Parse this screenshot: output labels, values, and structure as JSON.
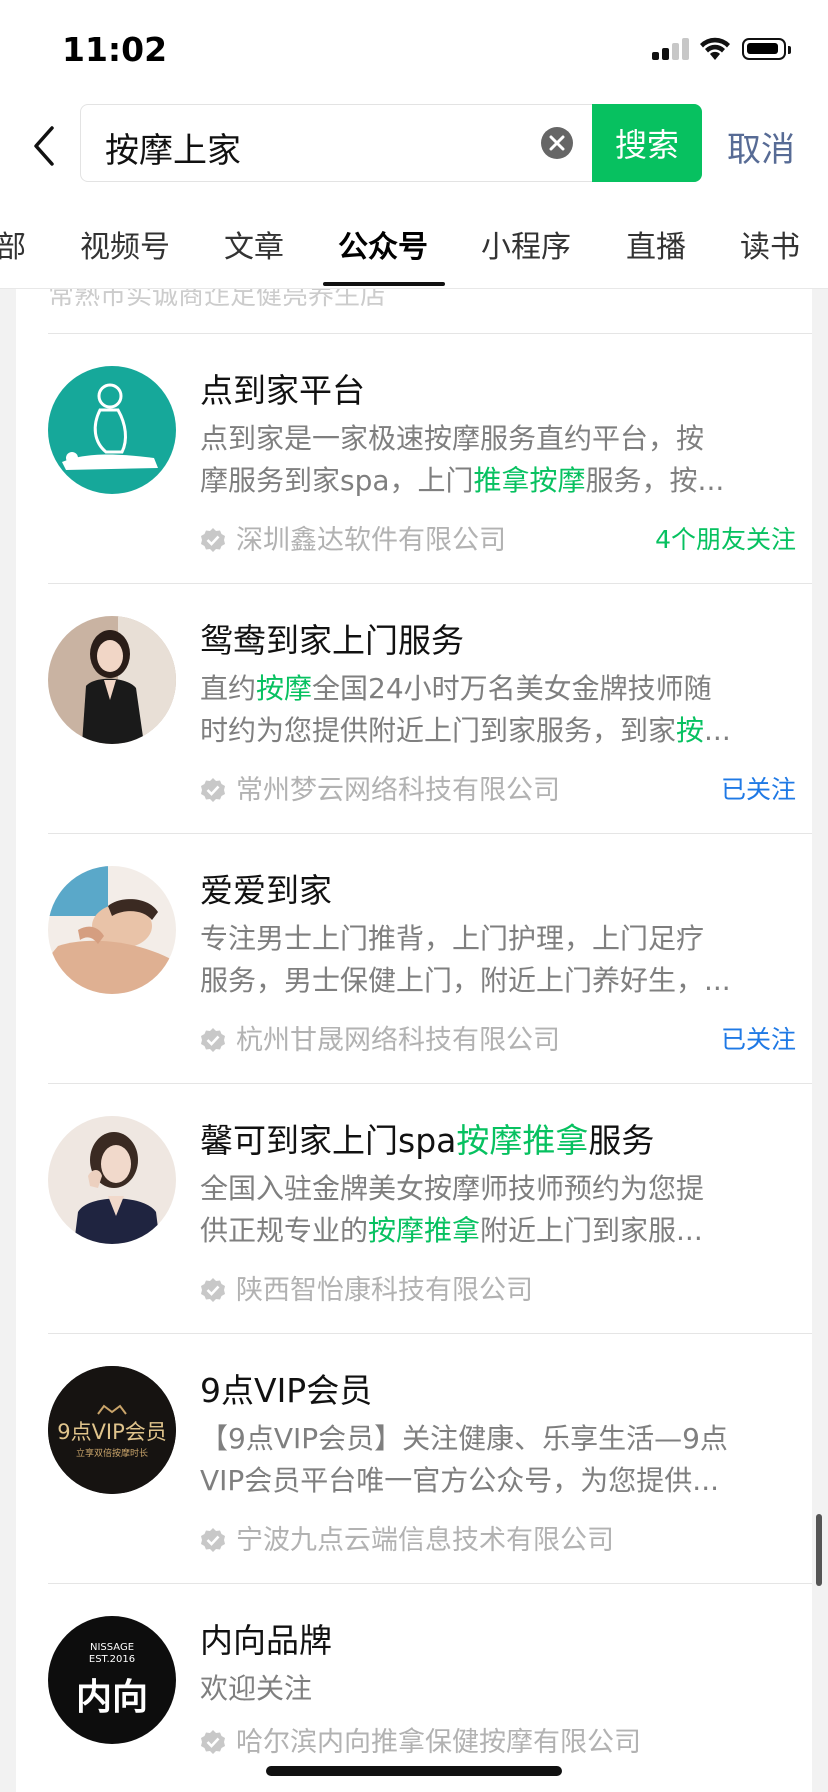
{
  "status_bar": {
    "time": "11:02"
  },
  "search": {
    "query": "按摩上家",
    "button_label": "搜索",
    "cancel_label": "取消"
  },
  "tabs": [
    {
      "label": "部"
    },
    {
      "label": "视频号"
    },
    {
      "label": "文章"
    },
    {
      "label": "公众号",
      "active": true
    },
    {
      "label": "小程序"
    },
    {
      "label": "直播"
    },
    {
      "label": "读书"
    }
  ],
  "clipped_row": {
    "owner": "常熟市实诚商迮足健亮养生店"
  },
  "results": [
    {
      "name_parts": [
        "点到家平台",
        "",
        ""
      ],
      "desc_line1": [
        "点到家是一家极速按摩服务直约平台，按",
        "",
        ""
      ],
      "desc_line2": [
        "摩服务到家spa，上门",
        "推拿按摩",
        "服务，按..."
      ],
      "owner": "深圳鑫达软件有限公司",
      "meta": "4个朋友关注"
    },
    {
      "name_parts": [
        "鸳鸯到家上门服务",
        "",
        ""
      ],
      "desc_line1": [
        "直约",
        "按摩",
        "全国24小时万名美女金牌技师随"
      ],
      "desc_line2": [
        "时约为您提供附近上门到家服务，到家",
        "按",
        "..."
      ],
      "owner": "常州梦云网络科技有限公司",
      "meta": "已关注"
    },
    {
      "name_parts": [
        "爱爱到家",
        "",
        ""
      ],
      "desc_line1": [
        "专注男士上门推背，上门护理，上门足疗",
        "",
        ""
      ],
      "desc_line2": [
        "服务，男士保健上门，附近上门养好生，...",
        "",
        ""
      ],
      "owner": "杭州甘晟网络科技有限公司",
      "meta": "已关注"
    },
    {
      "name_parts": [
        "馨可到家上门spa",
        "按摩推拿",
        "服务"
      ],
      "desc_line1": [
        "全国入驻金牌美女按摩师技师预约为您提",
        "",
        ""
      ],
      "desc_line2": [
        "供正规专业的",
        "按摩推拿",
        "附近上门到家服..."
      ],
      "owner": "陕西智怡康科技有限公司",
      "meta": ""
    },
    {
      "name_parts": [
        "9点VIP会员",
        "",
        ""
      ],
      "desc_line1": [
        "【9点VIP会员】关注健康、乐享生活—9点",
        "",
        ""
      ],
      "desc_line2": [
        "VIP会员平台唯一官方公众号，为您提供...",
        "",
        ""
      ],
      "owner": "宁波九点云端信息技术有限公司",
      "meta": "",
      "logo_text": "9点VIP会员",
      "logo_sub": "立享双倍按摩时长"
    },
    {
      "name_parts": [
        "内向品牌",
        "",
        ""
      ],
      "desc_line1": [
        "欢迎关注",
        "",
        ""
      ],
      "desc_line2": [
        "",
        "",
        ""
      ],
      "owner": "哈尔滨内向推拿保健按摩有限公司",
      "meta": "",
      "logo_text": "内向",
      "logo_sub": "NISSAGE EST.2016"
    }
  ],
  "colors": {
    "accent": "#07c160",
    "link": "#576b95",
    "followed": "#1f79e5"
  }
}
